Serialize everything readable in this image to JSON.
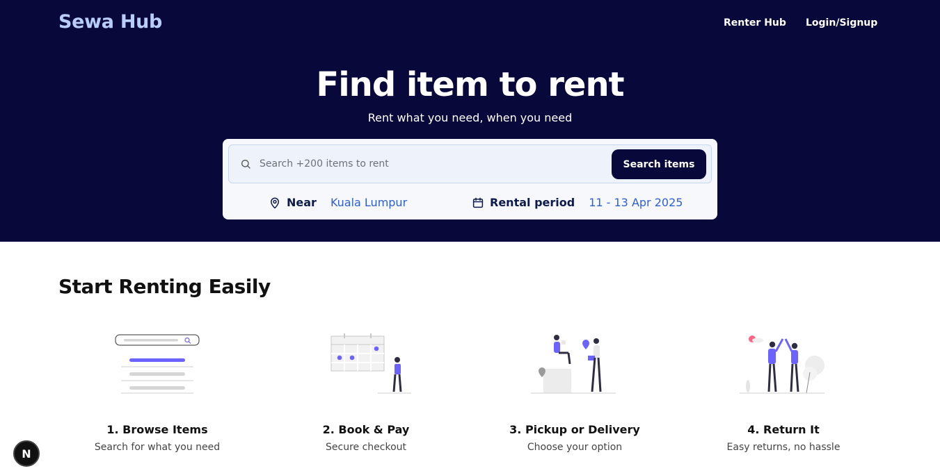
{
  "header": {
    "brand": "Sewa Hub",
    "nav": [
      "Renter Hub",
      "Login/Signup"
    ]
  },
  "hero": {
    "title": "Find item to rent",
    "subtitle": "Rent what you need, when you need"
  },
  "search": {
    "placeholder": "Search +200 items to rent",
    "button_label": "Search items",
    "location_label": "Near",
    "location_value": "Kuala Lumpur",
    "period_label": "Rental period",
    "period_value": "11 - 13 Apr 2025"
  },
  "section": {
    "title": "Start Renting Easily",
    "steps": [
      {
        "title": "1. Browse Items",
        "desc": "Search for what you need",
        "icon": "browse-illustration"
      },
      {
        "title": "2. Book & Pay",
        "desc": "Secure checkout",
        "icon": "calendar-booking-illustration"
      },
      {
        "title": "3. Pickup or Delivery",
        "desc": "Choose your option",
        "icon": "delivery-illustration"
      },
      {
        "title": "4. Return It",
        "desc": "Easy returns, no hassle",
        "icon": "high-five-illustration"
      }
    ]
  },
  "badge": {
    "label": "N"
  },
  "colors": {
    "hero_bg": "#08083a",
    "brand": "#b9cdfb",
    "accent": "#6c63ff",
    "link": "#2f5fcf"
  }
}
